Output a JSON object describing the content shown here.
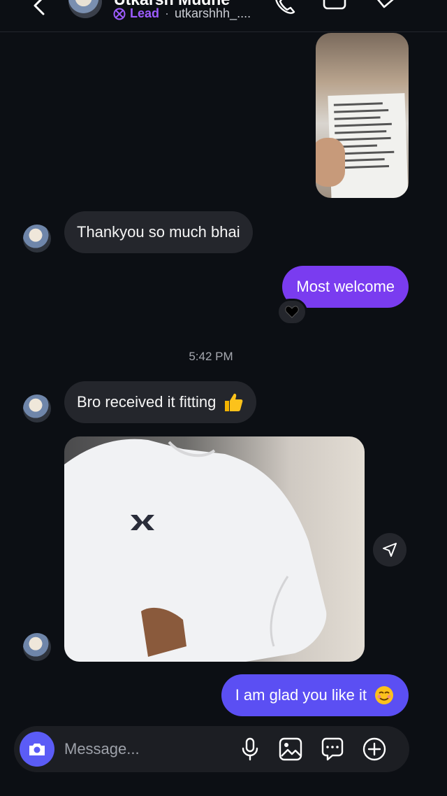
{
  "header": {
    "contact_name": "Utkarsh Mudhe",
    "label": "Lead",
    "separator": "·",
    "username": "utkarshhh_...."
  },
  "messages": {
    "received_1": "Thankyou so much bhai",
    "sent_1": "Most welcome",
    "reaction": "black-heart",
    "timestamp": "5:42 PM",
    "received_2": "Bro received it fitting",
    "sent_2": "I am glad you like it"
  },
  "composer": {
    "placeholder": "Message..."
  },
  "colors": {
    "background": "#0c0f14",
    "incoming_bubble": "#24262c",
    "outgoing_bubble": "#7a3cf0",
    "outgoing_bubble_blue": "#5b4ff3",
    "accent": "#5b5cf6",
    "lead_label": "#9d5cff"
  },
  "icons": [
    "back-arrow-icon",
    "phone-icon",
    "video-icon",
    "tag-icon",
    "lead-icon",
    "camera-icon",
    "microphone-icon",
    "gallery-icon",
    "sticker-icon",
    "plus-icon",
    "share-icon",
    "thumbs-up-emoji",
    "smiling-emoji"
  ]
}
